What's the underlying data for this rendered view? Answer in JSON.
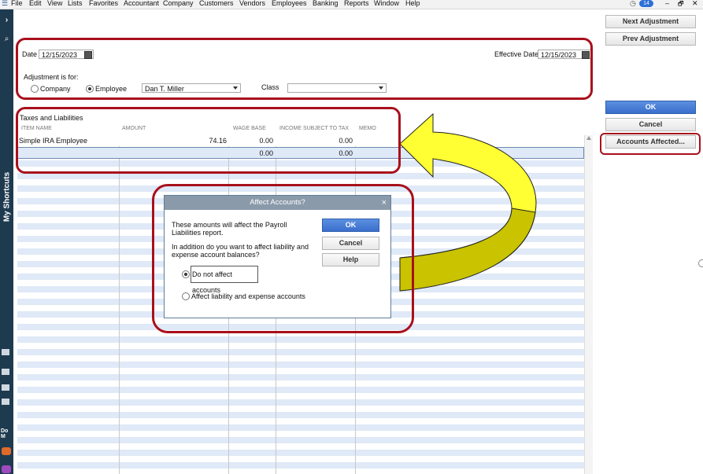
{
  "menu": {
    "items": [
      "File",
      "Edit",
      "View",
      "Lists",
      "Favorites",
      "Accountant",
      "Company",
      "Customers",
      "Vendors",
      "Employees",
      "Banking",
      "Reports",
      "Window",
      "Help"
    ],
    "badge": "14",
    "window_controls": [
      "–",
      "🗗",
      "✕"
    ]
  },
  "rail": {
    "shortcuts_label": "My Shortcuts",
    "do_more_label": "Do M"
  },
  "form": {
    "date_label": "Date",
    "date_value": "12/15/2023",
    "effective_date_label": "Effective Date",
    "effective_date_value": "12/15/2023",
    "adjustment_for_label": "Adjustment is for:",
    "company_label": "Company",
    "employee_label": "Employee",
    "employee_value": "Dan T. Miller",
    "class_label": "Class",
    "class_value": "",
    "selected_target": "Employee"
  },
  "table": {
    "section_title": "Taxes and Liabilities",
    "columns": [
      "ITEM NAME",
      "AMOUNT",
      "WAGE BASE",
      "INCOME SUBJECT TO TAX",
      "MEMO"
    ],
    "rows": [
      [
        "Simple IRA Employee",
        "74.16",
        "0.00",
        "0.00",
        ""
      ],
      [
        "",
        "",
        "0.00",
        "0.00",
        ""
      ]
    ]
  },
  "buttons": {
    "next_adjustment": "Next Adjustment",
    "prev_adjustment": "Prev Adjustment",
    "ok": "OK",
    "cancel": "Cancel",
    "accounts_affected": "Accounts Affected..."
  },
  "dialog": {
    "title": "Affect Accounts?",
    "close": "×",
    "message1": "These amounts will affect the Payroll Liabilities report.",
    "message2": "In addition do you want to affect liability and expense account balances?",
    "option1": "Do not affect accounts",
    "option2": "Affect liability and expense accounts",
    "selected_option": "Do not affect accounts",
    "ok": "OK",
    "cancel": "Cancel",
    "help": "Help"
  },
  "colors": {
    "highlight_red": "#a8101c",
    "arrow_yellow": "#ffff33",
    "ok_blue": "#3a6fcc",
    "rail": "#1e3a4f"
  }
}
